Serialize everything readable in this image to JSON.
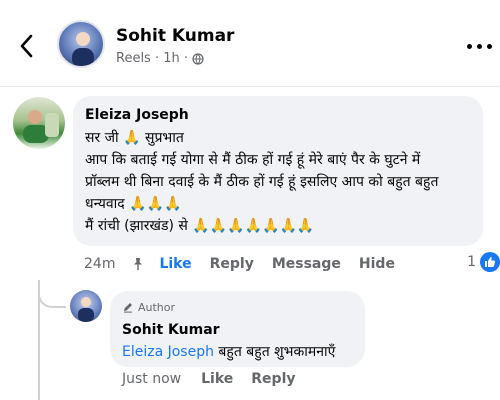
{
  "header": {
    "author_name": "Sohit Kumar",
    "meta_text": "Reels · 1h ·",
    "back_icon": "chevron-left-icon",
    "more_icon": "more-horizontal-icon"
  },
  "comment": {
    "author": "Eleiza Joseph",
    "lines": [
      "सर जी 🙏 सुप्रभात",
      "आप कि बताई गई योगा से मैं ठीक हों गई हूं मेरे बाएं पैर के घुटने में",
      "प्रॉब्लम थी बिना दवाई के मैं ठीक हों गई हूं इसलिए आप को बहुत बहुत",
      "धन्यवाद 🙏🙏🙏",
      "मैं रांची (झारखंड) से 🙏🙏🙏🙏🙏🙏🙏"
    ],
    "time": "24m",
    "like_label": "Like",
    "reply_label": "Reply",
    "message_label": "Message",
    "hide_label": "Hide",
    "reaction_count": "1"
  },
  "reply": {
    "badge": "Author",
    "author": "Sohit Kumar",
    "mention": "Eleiza Joseph",
    "text": " बहुत बहुत शुभकामनाएँ",
    "time": "Just now",
    "like_label": "Like",
    "reply_label": "Reply"
  },
  "colors": {
    "accent": "#1877f2",
    "bubble": "#f0f2f5",
    "muted": "#65676b"
  }
}
